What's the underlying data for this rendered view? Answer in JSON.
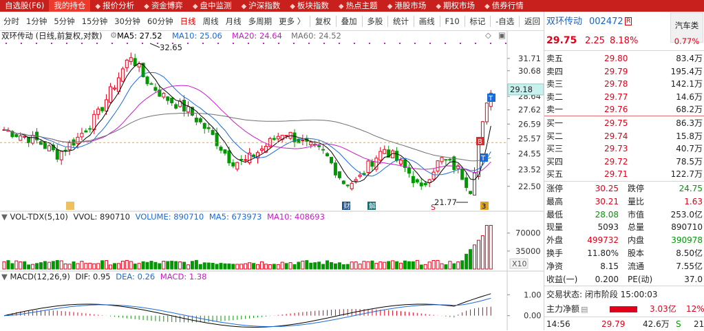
{
  "nav": [
    "自选股(F6)",
    "我的持仓",
    "报价分析",
    "资金博弈",
    "盘中监测",
    "沪深指数",
    "板块指数",
    "热点主题",
    "港股市场",
    "期权市场",
    "债券行情"
  ],
  "toolbar": {
    "periods": [
      "分时",
      "1分钟",
      "5分钟",
      "15分钟",
      "30分钟",
      "60分钟",
      "日线",
      "周线",
      "月线",
      "多周期",
      "更多 〉"
    ],
    "active_period": "日线",
    "tools": [
      "复权",
      "叠加",
      "多股",
      "统计",
      "画线",
      "F10",
      "标记",
      "-自选",
      "返回"
    ]
  },
  "main": {
    "title": "双环传动 (日线,前复权,对数)",
    "ma": [
      {
        "label": "MA5: 27.52",
        "color": "#000000"
      },
      {
        "label": "MA10: 25.06",
        "color": "#1a6bd8"
      },
      {
        "label": "MA20: 24.64",
        "color": "#c81cc8"
      },
      {
        "label": "MA60: 24.52",
        "color": "#707070"
      }
    ],
    "price_ticks": [
      "31.71",
      "30.68",
      "28.64",
      "27.62",
      "26.59",
      "25.57",
      "24.55",
      "23.52",
      "22.50"
    ],
    "current_price": "29.18",
    "high_mark": "32.65",
    "low_mark": "21.77",
    "markers": {
      "cai": "财",
      "jie": "解",
      "s": "S",
      "b": "B",
      "t": "T",
      "sanjia": "3"
    }
  },
  "volume": {
    "title": "VOL-TDX(5,10)",
    "vvol": "VVOL: 890710",
    "volume": "VOLUME: 890710",
    "ma5": "MA5: 673973",
    "ma10": "MA10: 408693",
    "ticks": [
      "70000",
      "35000"
    ],
    "unit": "X10"
  },
  "macd": {
    "title": "MACD(12,26,9)",
    "dif": "DIF: 0.95",
    "dea": "DEA: 0.26",
    "macd": "MACD: 1.38",
    "ticks": [
      "1.00",
      "0.00"
    ]
  },
  "quote": {
    "name": "双环传动",
    "code": "002472",
    "badge": "R",
    "industry": "汽车类",
    "price": "29.75",
    "change": "2.25",
    "pct": "8.18%",
    "industry_pct": "0.77%",
    "asks": [
      {
        "label": "卖五",
        "price": "29.80",
        "vol": "83.4万"
      },
      {
        "label": "卖四",
        "price": "29.79",
        "vol": "195.4万"
      },
      {
        "label": "卖三",
        "price": "29.78",
        "vol": "142.1万"
      },
      {
        "label": "卖二",
        "price": "29.77",
        "vol": "14.6万"
      },
      {
        "label": "卖一",
        "price": "29.76",
        "vol": "68.2万"
      }
    ],
    "bids": [
      {
        "label": "买一",
        "price": "29.75",
        "vol": "86.3万"
      },
      {
        "label": "买二",
        "price": "29.74",
        "vol": "15.8万"
      },
      {
        "label": "买三",
        "price": "29.73",
        "vol": "40.7万"
      },
      {
        "label": "买四",
        "price": "29.72",
        "vol": "78.5万"
      },
      {
        "label": "买五",
        "price": "29.71",
        "vol": "122.7万"
      }
    ],
    "stats": [
      [
        "涨停",
        "30.25",
        "跌停",
        "24.75"
      ],
      [
        "最高",
        "30.21",
        "量比",
        "1.63"
      ],
      [
        "最低",
        "28.08",
        "市值",
        "253.0亿"
      ],
      [
        "现量",
        "5093",
        "总量",
        "890710"
      ],
      [
        "外盘",
        "499732",
        "内盘",
        "390978"
      ],
      [
        "换手",
        "11.80%",
        "股本",
        "8.50亿"
      ],
      [
        "净资",
        "8.15",
        "流通",
        "7.55亿"
      ],
      [
        "收益(一)",
        "0.200",
        "PE(动)",
        "37.0"
      ]
    ],
    "trade_status": "交易状态: 闭市阶段 15:00:03",
    "main_net_label": "主力净额",
    "main_net_value": "3.03亿",
    "main_net_pct": "12%",
    "tick": {
      "time": "14:56",
      "price": "29.79",
      "vol": "42.6万",
      "side": "S",
      "n": "21"
    }
  },
  "colors": {
    "up": "#e0001a",
    "down": "#009900",
    "accent": "#c8201c"
  }
}
